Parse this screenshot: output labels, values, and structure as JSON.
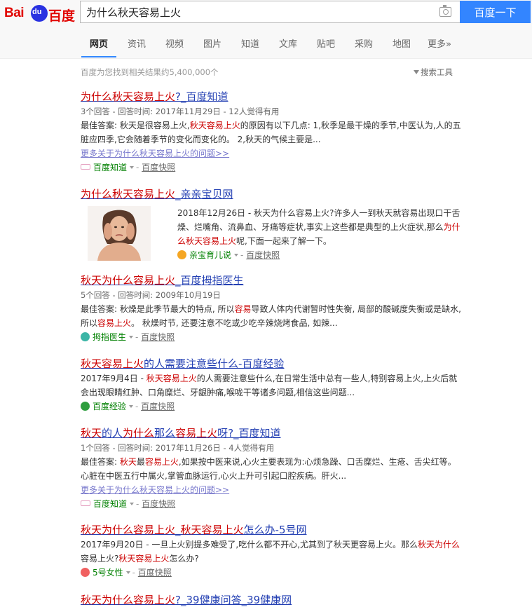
{
  "header": {
    "logo_text_left": "Bai",
    "logo_paw_text": "du",
    "logo_text_right": "百度",
    "search_value": "为什么秋天容易上火",
    "search_button": "百度一下",
    "tabs": [
      "网页",
      "资讯",
      "视频",
      "图片",
      "知道",
      "文库",
      "贴吧",
      "采购",
      "地图",
      "更多»"
    ]
  },
  "result_count": "百度为您找到相关结果约5,400,000个",
  "search_tools": "搜索工具",
  "results": [
    {
      "title_hl": "为什么秋天容易上火",
      "title_tail": "?_百度知道",
      "meta": "3个回答 - 回答时间: 2017年11月29日 - 12人觉得有用",
      "abstract_1": "最佳答案: 秋天是很容易上火,",
      "abstract_hl": "秋天容易上火",
      "abstract_2": "的原因有以下几点: 1,秋季是最干燥的季节,中医认为,人的五脏应四季,它会随着季节的变化而变化的。 2,秋天的气候主要是...",
      "more_link": "更多关于为什么秋天容易上火的问题>>",
      "source": "百度知道",
      "snapshot": "百度快照"
    },
    {
      "title_hl": "为什么秋天容易上火",
      "title_tail": "_亲亲宝贝网",
      "abstract_1": "2018年12月26日 - 秋天为什么容易上火?许多人一到秋天就容易出现口干舌燥、烂嘴角、流鼻血、牙痛等症状,事实上这些都是典型的上火症状,那么",
      "abstract_hl": "为什么秋天容易上火",
      "abstract_2": "呢,下面一起来了解一下。",
      "source": "亲宝育儿说",
      "snapshot": "百度快照"
    },
    {
      "title_hl": "秋天为什么容易上火",
      "title_tail": "_百度拇指医生",
      "meta": "5个回答 - 回答时间: 2009年10月19日",
      "abstract_1": "最佳答案: 秋燥是此季节最大的特点, 所以",
      "abstract_hl": "容易",
      "abstract_2": "导致人体内代谢暂时性失衡, 局部的酸碱度失衡或是缺水, 所以",
      "abstract_hl2": "容易上火",
      "abstract_3": "。 秋燥时节, 还要注意不吃或少吃辛辣烧烤食品, 如辣...",
      "source": "拇指医生",
      "snapshot": "百度快照"
    },
    {
      "title_hl": "秋天容易上火",
      "title_tail": "的人需要注意些什么-百度经验",
      "abstract_1": "2017年9月4日 - ",
      "abstract_hl": "秋天容易上火",
      "abstract_2": "的人需要注意些什么,在日常生活中总有一些人,特别容易上火,上火后就会出现眼睛红肿、口角糜烂、牙龈肿痛,喉咙干等诸多问题,相信这些问题...",
      "source": "百度经验",
      "snapshot": "百度快照"
    },
    {
      "title_hl": "秋天",
      "title_mid": "的人",
      "title_hl2": "为什么",
      "title_mid2": "那么",
      "title_hl3": "容易上火",
      "title_tail": "呀?_百度知道",
      "meta": "1个回答 - 回答时间: 2017年11月26日 - 4人觉得有用",
      "abstract_1": "最佳答案: ",
      "abstract_hl": "秋天",
      "abstract_2": "最",
      "abstract_hl2": "容易上火",
      "abstract_3": ",如果按中医来说,心火主要表现为:心烦急躁、口舌糜烂、生疮、舌尖红等。心脏在中医五行中属火,掌管血脉运行,心火上升可引起口腔疾病。肝火...",
      "more_link": "更多关于为什么秋天容易上火的问题>>",
      "source": "百度知道",
      "snapshot": "百度快照"
    },
    {
      "title_hl": "秋天为什么容易上火",
      "title_mid": "_",
      "title_hl2": "秋天容易上火",
      "title_tail": "怎么办-5号网",
      "abstract_1": "2017年9月20日 - 一旦上火别提多难受了,吃什么都不开心,尤其到了秋天更容易上火。那么",
      "abstract_hl": "秋天为什么",
      "abstract_2": "容易上火?",
      "abstract_hl2": "秋天容易上火",
      "abstract_3": "怎么办?",
      "source": "5号女性",
      "snapshot": "百度快照"
    },
    {
      "title_hl": "秋天为什么容易上火",
      "title_tail": "?_39健康问答_39健康网"
    }
  ],
  "colors": {
    "accent": "#3385ff",
    "link": "#2440b3",
    "highlight": "#c00",
    "source_green": "#008000"
  },
  "icons": [
    "camera-icon",
    "filter-icon",
    "baidu-zhidao-icon",
    "qinbao-icon",
    "muzhi-doctor-icon",
    "baidu-jingyan-icon",
    "5hao-icon"
  ]
}
